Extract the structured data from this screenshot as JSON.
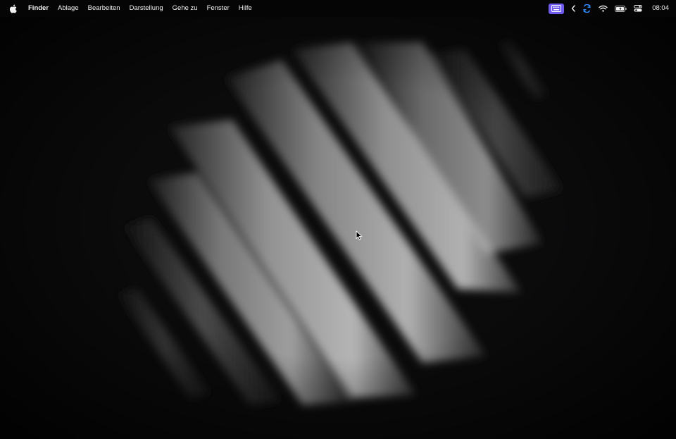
{
  "menubar": {
    "apple_icon": "apple-icon",
    "app_name": "Finder",
    "items": [
      "Ablage",
      "Bearbeiten",
      "Darstellung",
      "Gehe zu",
      "Fenster",
      "Hilfe"
    ],
    "status_icons": [
      "keyboard-viewer-icon",
      "chevron-left-icon",
      "onedrive-sync-icon",
      "wifi-icon",
      "battery-icon",
      "control-center-icon"
    ],
    "clock": "08:04",
    "accent_color": "#6f5bf0"
  },
  "desktop": {
    "wallpaper": "dark-diagonal-light-bands",
    "cursor_icon": "arrow-cursor-icon"
  }
}
